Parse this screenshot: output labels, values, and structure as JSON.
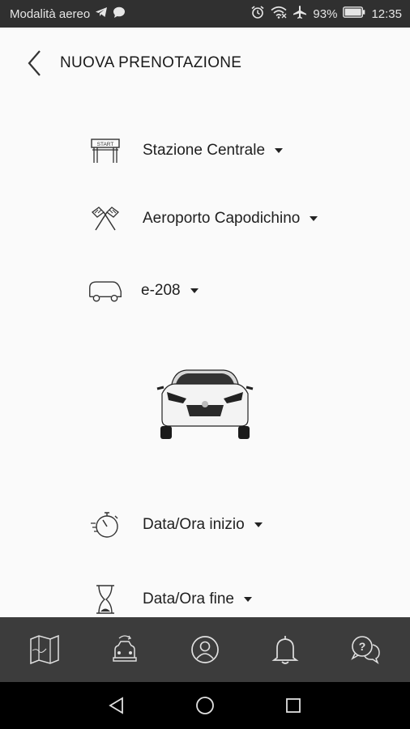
{
  "status": {
    "carrier": "Modalità aereo",
    "battery": "93%",
    "time": "12:35"
  },
  "header": {
    "title": "NUOVA PRENOTAZIONE"
  },
  "form": {
    "start_location": "Stazione Centrale",
    "end_location": "Aeroporto Capodichino",
    "vehicle": "e-208",
    "start_datetime": "Data/Ora inizio",
    "end_datetime": "Data/Ora fine"
  },
  "icons": {
    "start": "start-sign-icon",
    "finish": "finish-flags-icon",
    "vehicle": "car-icon",
    "start_time": "stopwatch-icon",
    "end_time": "hourglass-icon",
    "tabs": [
      "map-icon",
      "car-booking-icon",
      "user-profile-icon",
      "bell-icon",
      "help-chat-icon"
    ]
  },
  "colors": {
    "background": "#fafafa",
    "status_bar": "#303030",
    "tab_bar": "#3c3c3c",
    "nav_bar": "#000000"
  }
}
